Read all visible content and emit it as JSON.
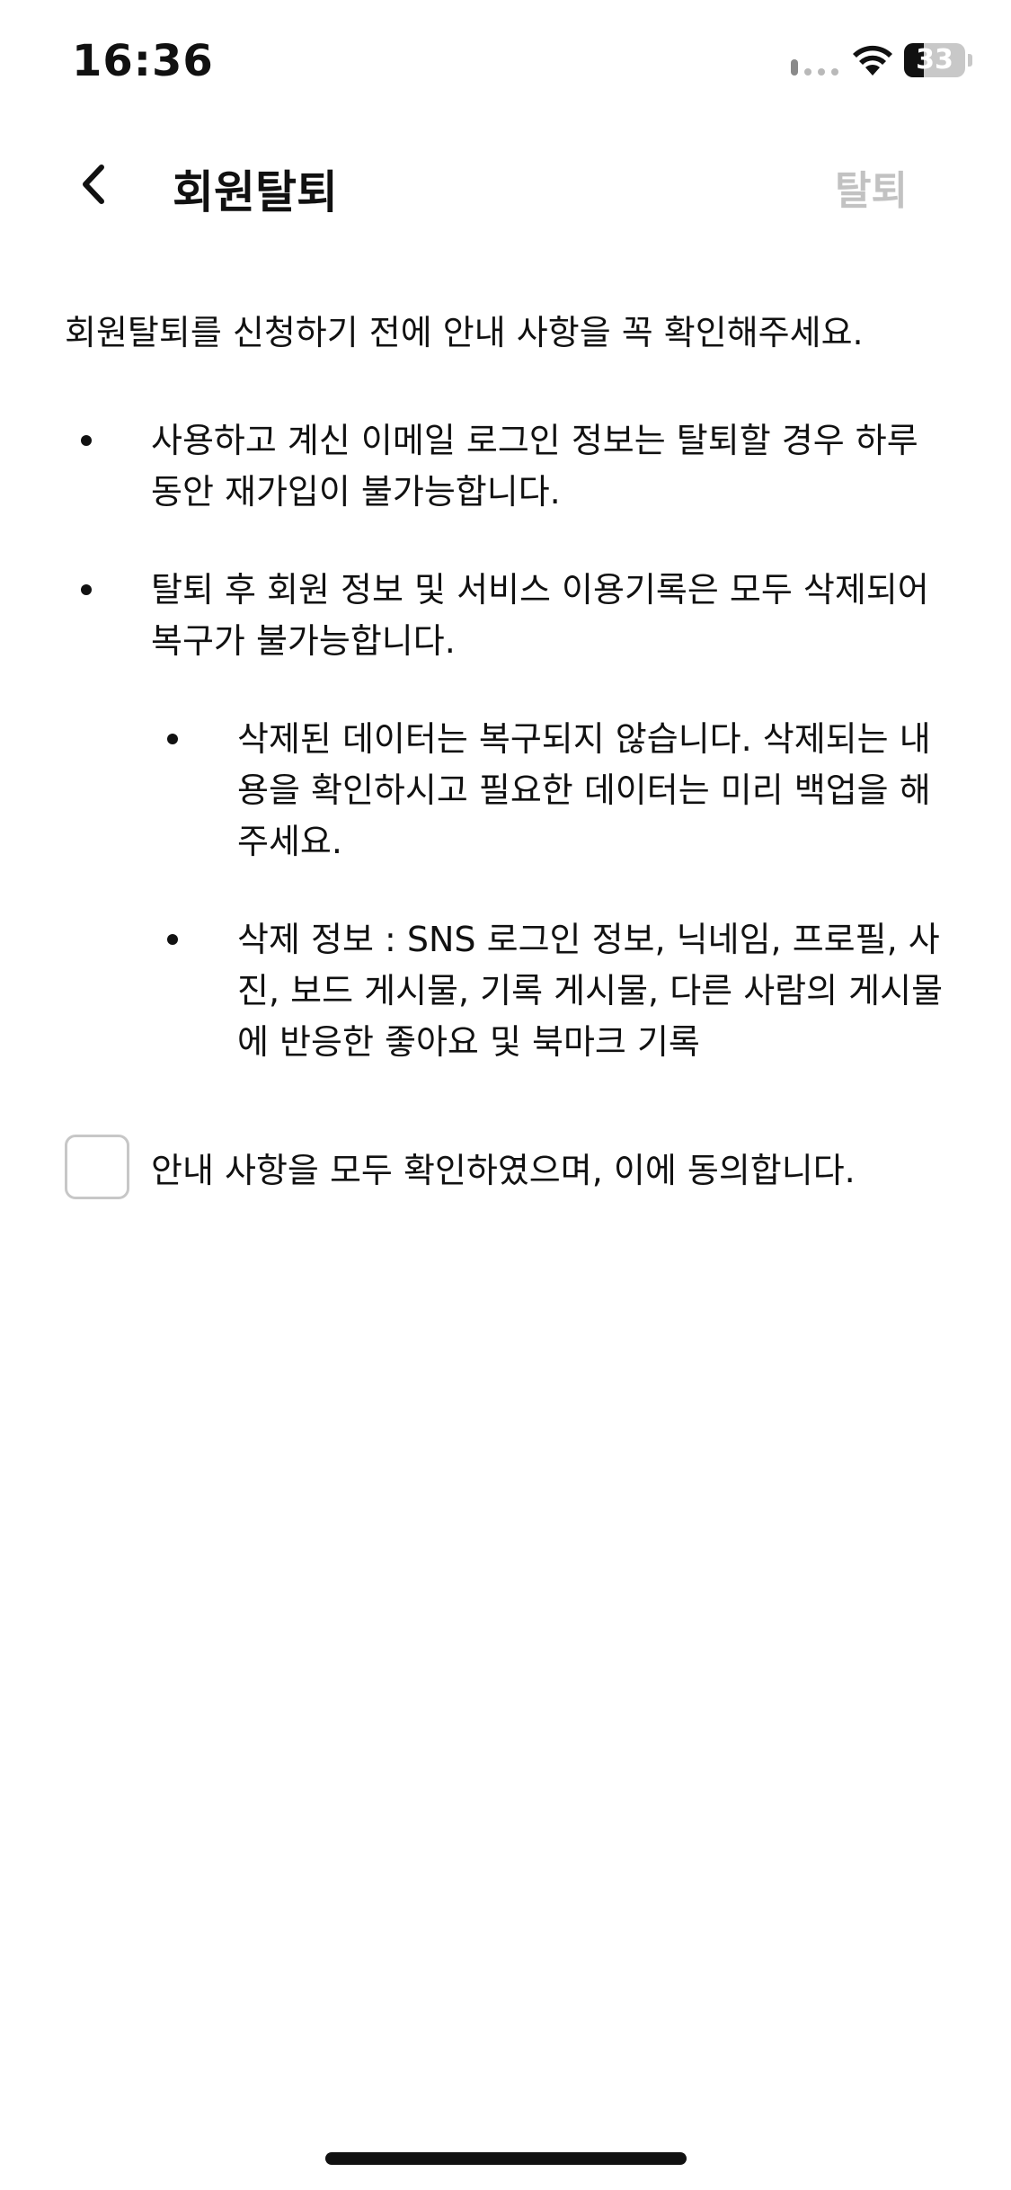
{
  "status_bar": {
    "time": "16:36",
    "battery_level": "33",
    "battery_fraction": 0.33
  },
  "nav": {
    "title": "회원탈퇴",
    "back_icon": "chevron-left-icon",
    "withdraw_label": "탈퇴"
  },
  "content": {
    "intro": "회원탈퇴를 신청하기 전에 안내 사항을 꼭 확인해주세요.",
    "notices": [
      "사용하고 계신 이메일 로그인 정보는 탈퇴할 경우 하루 동안 재가입이 불가능합니다.",
      "탈퇴 후 회원 정보 및 서비스 이용기록은 모두 삭제되어 복구가 불가능합니다."
    ],
    "sub_notices": [
      "삭제된 데이터는 복구되지 않습니다. 삭제되는 내용을 확인하시고 필요한 데이터는 미리 백업을 해주세요.",
      "삭제 정보 : SNS 로그인 정보, 닉네임, 프로필, 사진, 보드 게시물, 기록 게시물, 다른 사람의 게시물에 반응한 좋아요 및 북마크 기록"
    ]
  },
  "agree": {
    "label": "안내 사항을 모두 확인하였으며, 이에 동의합니다.",
    "checked": false
  },
  "colors": {
    "text": "#111111",
    "disabled": "#c2c2c2",
    "checkbox_border": "#c7c7c7",
    "background": "#ffffff"
  }
}
